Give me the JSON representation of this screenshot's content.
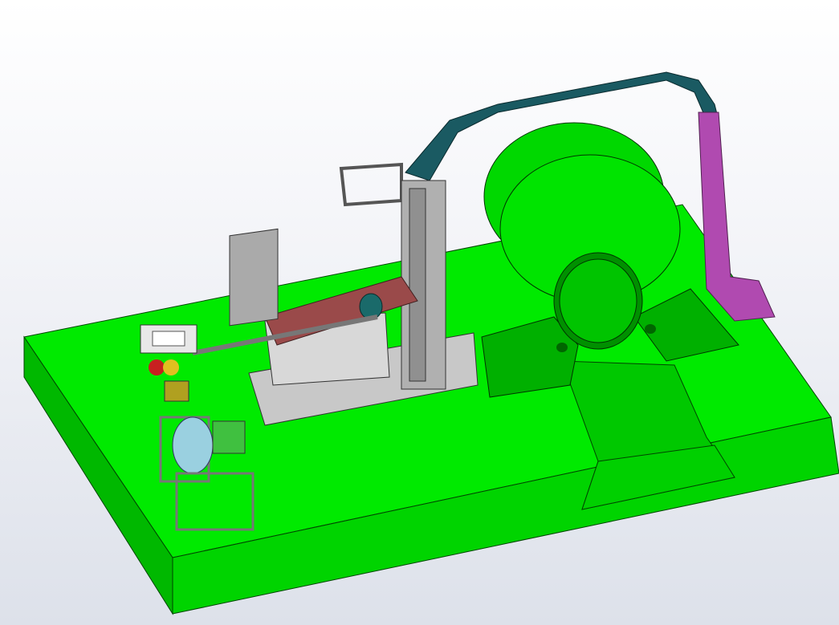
{
  "scene": {
    "description_colors": {
      "platform_top": "#00ea00",
      "platform_side_dark": "#00b800",
      "platform_front": "#00d400",
      "drum": "#00e000",
      "frame_teal": "#1a5a62",
      "support_magenta": "#b04ab0",
      "arm_red": "#9a4a4a",
      "machine_gray": "#b8b8b8"
    }
  }
}
